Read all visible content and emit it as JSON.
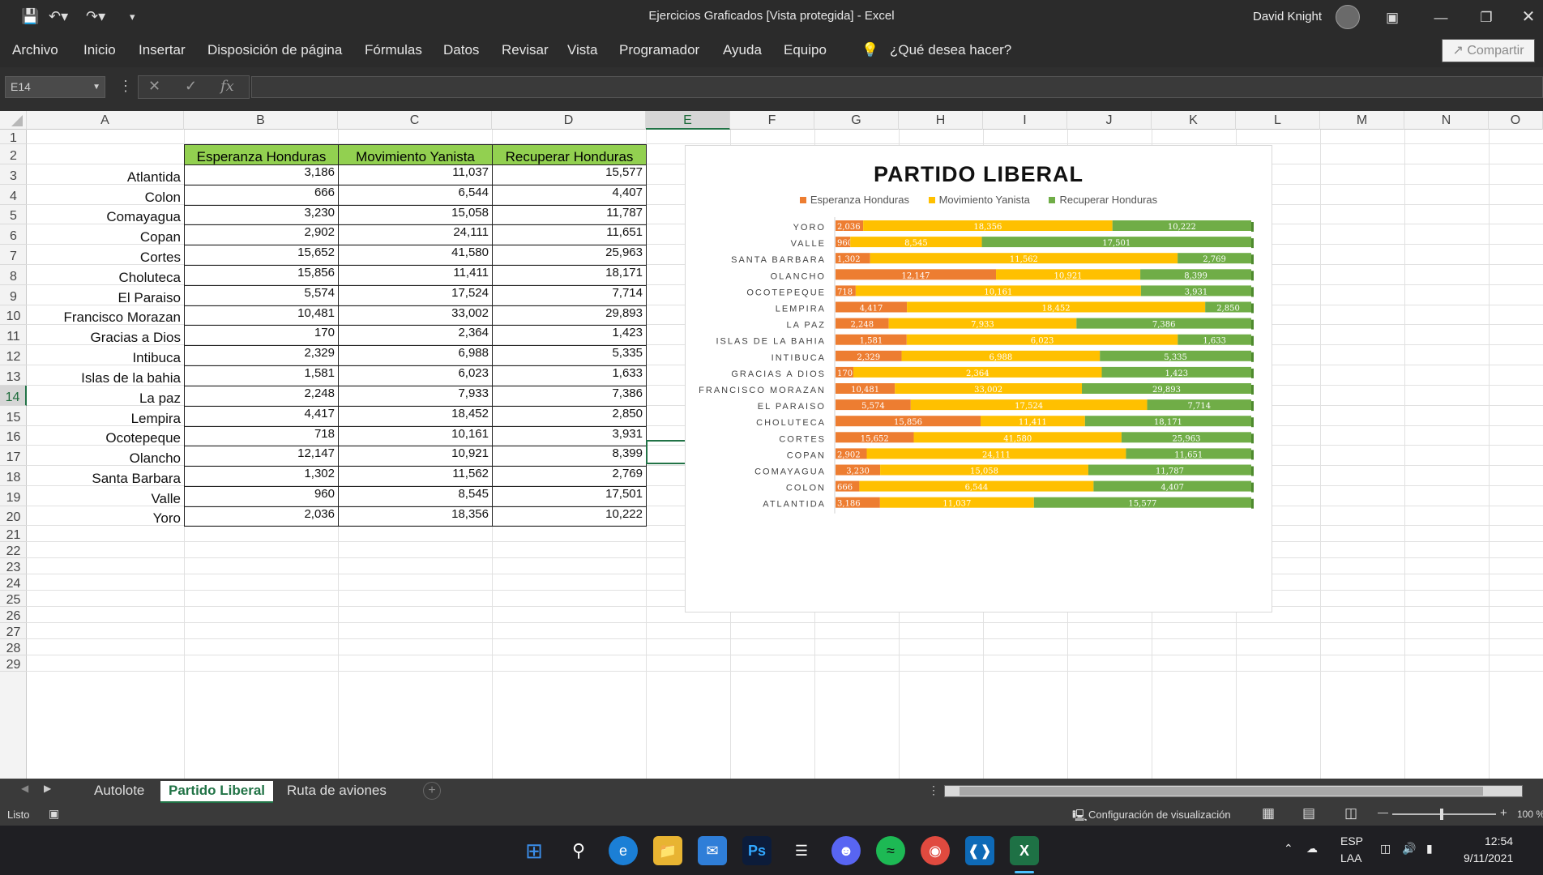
{
  "window": {
    "title": "Ejercicios Graficados  [Vista protegida]  -  Excel",
    "user": "David Knight"
  },
  "menu": [
    "Archivo",
    "Inicio",
    "Insertar",
    "Disposición de página",
    "Fórmulas",
    "Datos",
    "Revisar",
    "Vista",
    "Programador",
    "Ayuda",
    "Equipo"
  ],
  "tellme": "¿Qué desea hacer?",
  "share": "Compartir",
  "namebox": "E14",
  "columns": [
    "A",
    "B",
    "C",
    "D",
    "E",
    "F",
    "G",
    "H",
    "I",
    "J",
    "K",
    "L",
    "M",
    "N",
    "O"
  ],
  "rows": [
    "1",
    "2",
    "3",
    "4",
    "5",
    "6",
    "7",
    "8",
    "9",
    "10",
    "11",
    "12",
    "13",
    "14",
    "15",
    "16",
    "17",
    "18",
    "19",
    "20",
    "21",
    "22",
    "23",
    "24",
    "25",
    "26",
    "27",
    "28",
    "29"
  ],
  "table": {
    "headers": [
      "Esperanza Honduras",
      "Movimiento Yanista",
      "Recuperar Honduras"
    ],
    "rows": [
      {
        "name": "Atlantida",
        "v": [
          "3,186",
          "11,037",
          "15,577"
        ]
      },
      {
        "name": "Colon",
        "v": [
          "666",
          "6,544",
          "4,407"
        ]
      },
      {
        "name": "Comayagua",
        "v": [
          "3,230",
          "15,058",
          "11,787"
        ]
      },
      {
        "name": "Copan",
        "v": [
          "2,902",
          "24,111",
          "11,651"
        ]
      },
      {
        "name": "Cortes",
        "v": [
          "15,652",
          "41,580",
          "25,963"
        ]
      },
      {
        "name": "Choluteca",
        "v": [
          "15,856",
          "11,411",
          "18,171"
        ]
      },
      {
        "name": "El Paraiso",
        "v": [
          "5,574",
          "17,524",
          "7,714"
        ]
      },
      {
        "name": "Francisco Morazan",
        "v": [
          "10,481",
          "33,002",
          "29,893"
        ]
      },
      {
        "name": "Gracias a Dios",
        "v": [
          "170",
          "2,364",
          "1,423"
        ]
      },
      {
        "name": "Intibuca",
        "v": [
          "2,329",
          "6,988",
          "5,335"
        ]
      },
      {
        "name": "Islas de la bahia",
        "v": [
          "1,581",
          "6,023",
          "1,633"
        ]
      },
      {
        "name": "La paz",
        "v": [
          "2,248",
          "7,933",
          "7,386"
        ]
      },
      {
        "name": "Lempira",
        "v": [
          "4,417",
          "18,452",
          "2,850"
        ]
      },
      {
        "name": "Ocotepeque",
        "v": [
          "718",
          "10,161",
          "3,931"
        ]
      },
      {
        "name": "Olancho",
        "v": [
          "12,147",
          "10,921",
          "8,399"
        ]
      },
      {
        "name": "Santa Barbara",
        "v": [
          "1,302",
          "11,562",
          "2,769"
        ]
      },
      {
        "name": "Valle",
        "v": [
          "960",
          "8,545",
          "17,501"
        ]
      },
      {
        "name": "Yoro",
        "v": [
          "2,036",
          "18,356",
          "10,222"
        ]
      }
    ]
  },
  "chart_data": {
    "type": "bar",
    "stacked": "100%",
    "orientation": "horizontal",
    "title": "PARTIDO LIBERAL",
    "legend_position": "top",
    "colors": [
      "#ed7d31",
      "#ffc000",
      "#70ad47"
    ],
    "categories": [
      "YORO",
      "VALLE",
      "SANTA BARBARA",
      "OLANCHO",
      "OCOTEPEQUE",
      "LEMPIRA",
      "LA PAZ",
      "ISLAS DE LA BAHIA",
      "INTIBUCA",
      "GRACIAS A DIOS",
      "FRANCISCO MORAZAN",
      "EL PARAISO",
      "CHOLUTECA",
      "CORTES",
      "COPAN",
      "COMAYAGUA",
      "COLON",
      "ATLANTIDA"
    ],
    "series": [
      {
        "name": "Esperanza Honduras",
        "values": [
          2036,
          960,
          1302,
          12147,
          718,
          4417,
          2248,
          1581,
          2329,
          170,
          10481,
          5574,
          15856,
          15652,
          2902,
          3230,
          666,
          3186
        ]
      },
      {
        "name": "Movimiento Yanista",
        "values": [
          18356,
          8545,
          11562,
          10921,
          10161,
          18452,
          7933,
          6023,
          6988,
          2364,
          33002,
          17524,
          11411,
          41580,
          24111,
          15058,
          6544,
          11037
        ]
      },
      {
        "name": "Recuperar Honduras",
        "values": [
          10222,
          17501,
          2769,
          8399,
          3931,
          2850,
          7386,
          1633,
          5335,
          1423,
          29893,
          7714,
          18171,
          25963,
          11651,
          11787,
          4407,
          15577
        ]
      }
    ]
  },
  "sheets": [
    "Autolote",
    "Partido Liberal",
    "Ruta de aviones"
  ],
  "status": {
    "ready": "Listo",
    "view_settings": "Configuración de visualización",
    "zoom": "100 %"
  },
  "tray": {
    "lang": "ESP",
    "layout": "LAA",
    "time": "12:54",
    "date": "9/11/2021"
  }
}
